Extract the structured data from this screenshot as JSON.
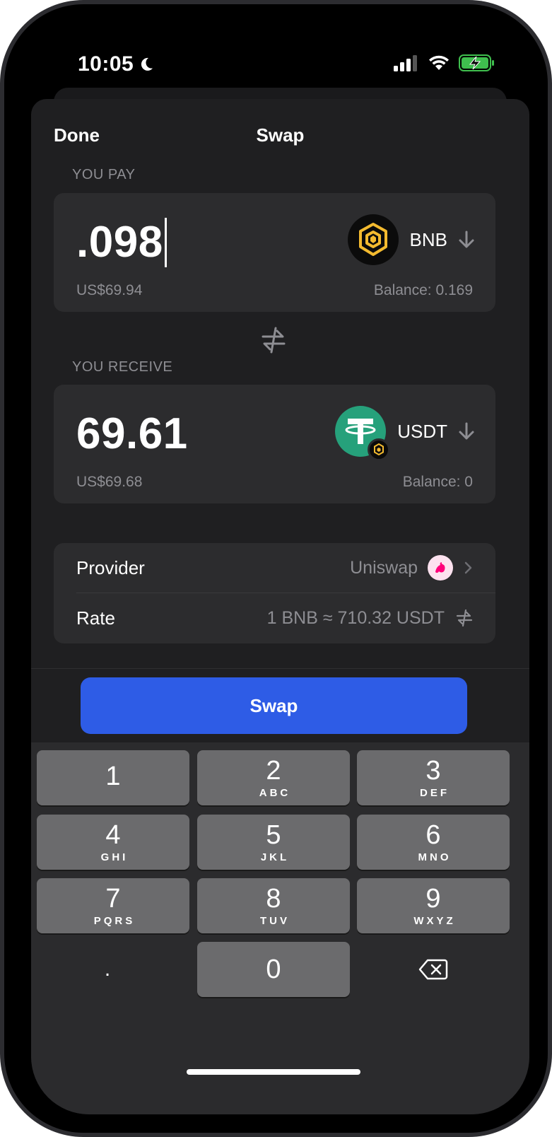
{
  "status_bar": {
    "time": "10:05",
    "icons": [
      "moon-icon",
      "cellular-signal-icon",
      "wifi-icon",
      "battery-charging-icon"
    ]
  },
  "nav": {
    "done_label": "Done",
    "title": "Swap"
  },
  "pay": {
    "section_label": "YOU PAY",
    "amount": ".098",
    "usd_value": "US$69.94",
    "balance": "Balance: 0.169",
    "token_symbol": "BNB"
  },
  "receive": {
    "section_label": "YOU RECEIVE",
    "amount": "69.61",
    "usd_value": "US$69.68",
    "balance": "Balance: 0",
    "token_symbol": "USDT"
  },
  "details": {
    "provider_label": "Provider",
    "provider_value": "Uniswap",
    "rate_label": "Rate",
    "rate_value": "1 BNB ≈ 710.32 USDT"
  },
  "swap_button": "Swap",
  "keypad": {
    "keys": [
      {
        "num": "1",
        "letters": ""
      },
      {
        "num": "2",
        "letters": "ABC"
      },
      {
        "num": "3",
        "letters": "DEF"
      },
      {
        "num": "4",
        "letters": "GHI"
      },
      {
        "num": "5",
        "letters": "JKL"
      },
      {
        "num": "6",
        "letters": "MNO"
      },
      {
        "num": "7",
        "letters": "PQRS"
      },
      {
        "num": "8",
        "letters": "TUV"
      },
      {
        "num": "9",
        "letters": "WXYZ"
      }
    ],
    "decimal": ".",
    "zero": "0"
  },
  "colors": {
    "accent": "#2e5ce6",
    "bnb_yellow": "#f3ba2f",
    "usdt_green": "#26a17b",
    "uniswap_pink": "#ff007a"
  }
}
